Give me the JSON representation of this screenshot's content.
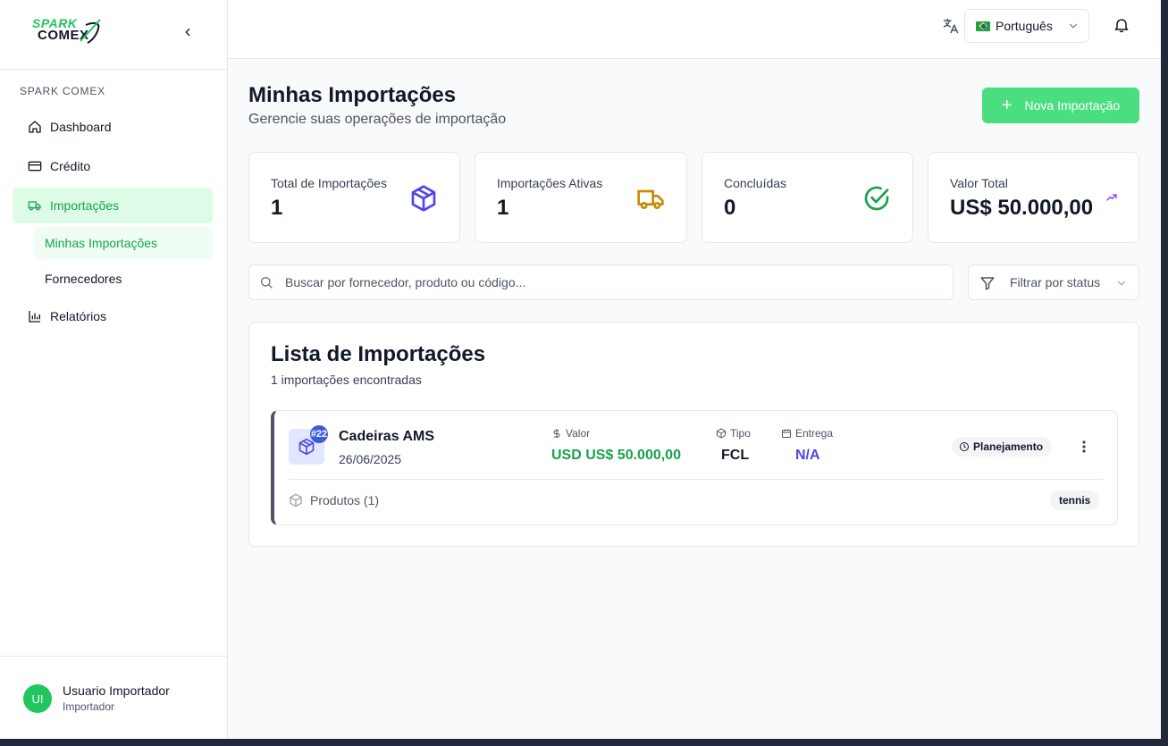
{
  "brand": {
    "line1": "SPARK",
    "line2": "COMEX"
  },
  "sidebar": {
    "section_title": "SPARK COMEX",
    "items": [
      {
        "label": "Dashboard",
        "icon": "home-icon"
      },
      {
        "label": "Crédito",
        "icon": "credit-card-icon"
      },
      {
        "label": "Importações",
        "icon": "truck-icon",
        "active": true
      }
    ],
    "sub_items": [
      {
        "label": "Minhas Importações",
        "active": true
      },
      {
        "label": "Fornecedores"
      }
    ],
    "reports": {
      "label": "Relatórios",
      "icon": "bar-chart-icon"
    }
  },
  "user": {
    "initials": "UI",
    "name": "Usuario Importador",
    "role": "Importador"
  },
  "topbar": {
    "language": "Português"
  },
  "page": {
    "title": "Minhas Importações",
    "subtitle": "Gerencie suas operações de importação",
    "new_button": "Nova Importação"
  },
  "stats": [
    {
      "label": "Total de Importações",
      "value": "1",
      "icon": "package-icon",
      "color": "#4f46e5"
    },
    {
      "label": "Importações Ativas",
      "value": "1",
      "icon": "truck-icon",
      "color": "#ca8a04"
    },
    {
      "label": "Concluídas",
      "value": "0",
      "icon": "check-circle-icon",
      "color": "#16a34a"
    },
    {
      "label": "Valor Total",
      "value": "US$ 50.000,00",
      "icon": "trending-up-icon",
      "color": "#9333ea"
    }
  ],
  "search": {
    "placeholder": "Buscar por fornecedor, produto ou código..."
  },
  "filter": {
    "label": "Filtrar por status"
  },
  "list": {
    "title": "Lista de Importações",
    "count_text": "1 importações encontradas",
    "items": [
      {
        "badge": "#22",
        "name": "Cadeiras AMS",
        "date": "26/06/2025",
        "value_label": "Valor",
        "value": "USD US$ 50.000,00",
        "type_label": "Tipo",
        "type": "FCL",
        "delivery_label": "Entrega",
        "delivery": "N/A",
        "status": "Planejamento",
        "products_label": "Produtos (1)",
        "tag": "tennis"
      }
    ]
  },
  "colors": {
    "accent": "#4ade80",
    "active_text": "#16a34a",
    "active_bg": "#dcfce7",
    "value_green": "#16a34a",
    "delivery_blue": "#4f46e5"
  }
}
